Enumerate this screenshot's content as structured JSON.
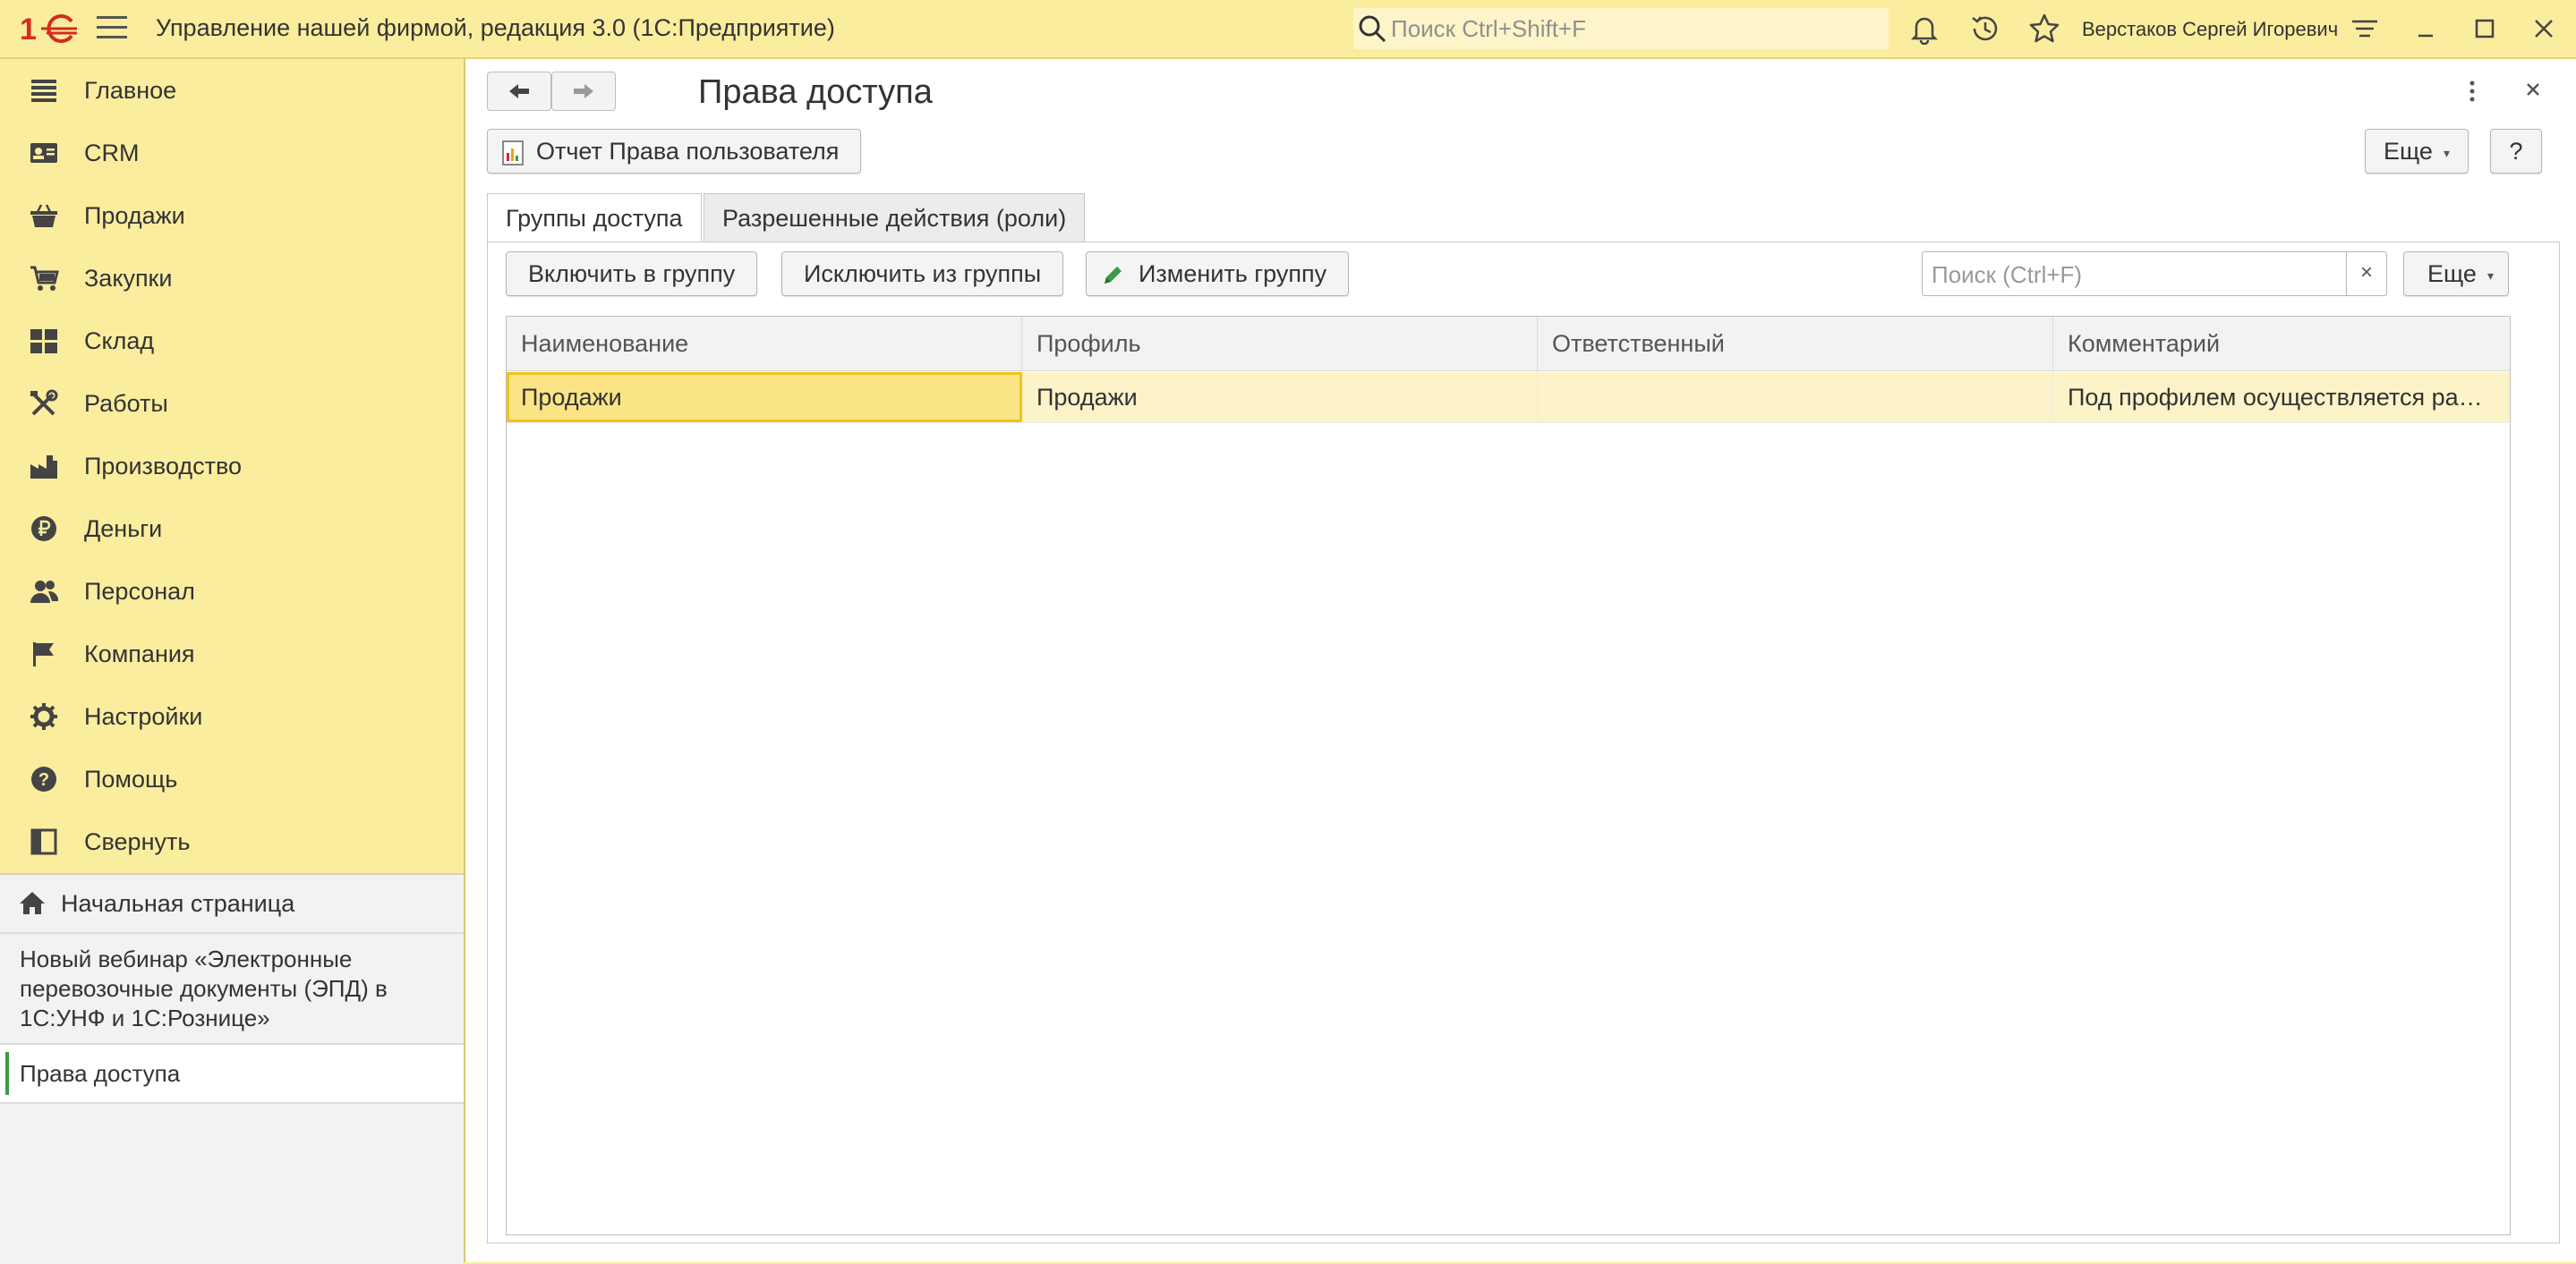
{
  "window": {
    "logo": "1С",
    "title": "Управление нашей фирмой, редакция 3.0  (1С:Предприятие)",
    "search_placeholder": "Поиск Ctrl+Shift+F",
    "user": "Верстаков Сергей Игоревич",
    "icons": [
      "menu-icon",
      "search-icon",
      "bell-icon",
      "history-icon",
      "star-icon",
      "settings-lines-icon",
      "minimize-icon",
      "maximize-icon",
      "close-icon"
    ]
  },
  "sidebar": {
    "items": [
      {
        "label": "Главное",
        "icon": "list-icon"
      },
      {
        "label": "CRM",
        "icon": "contact-card-icon"
      },
      {
        "label": "Продажи",
        "icon": "basket-icon"
      },
      {
        "label": "Закупки",
        "icon": "cart-icon"
      },
      {
        "label": "Склад",
        "icon": "grid-blocks-icon"
      },
      {
        "label": "Работы",
        "icon": "tools-icon"
      },
      {
        "label": "Производство",
        "icon": "factory-icon"
      },
      {
        "label": "Деньги",
        "icon": "ruble-icon"
      },
      {
        "label": "Персонал",
        "icon": "people-icon"
      },
      {
        "label": "Компания",
        "icon": "flag-icon"
      },
      {
        "label": "Настройки",
        "icon": "gear-icon"
      },
      {
        "label": "Помощь",
        "icon": "help-icon"
      },
      {
        "label": "Свернуть",
        "icon": "collapse-panel-icon"
      }
    ],
    "open_pages": {
      "home": "Начальная страница",
      "webinar": "Новый вебинар «Электронные перевозочные документы (ЭПД) в 1С:УНФ и 1С:Рознице»",
      "current": "Права доступа"
    }
  },
  "form": {
    "title": "Права доступа",
    "report_button": "Отчет Права пользователя",
    "more_button": "Еще",
    "help_button": "?",
    "tabs": [
      {
        "label": "Группы доступа",
        "active": true
      },
      {
        "label": "Разрешенные действия (роли)",
        "active": false
      }
    ],
    "toolbar": {
      "include": "Включить в группу",
      "exclude": "Исключить из группы",
      "edit": "Изменить группу",
      "search_placeholder": "Поиск (Ctrl+F)",
      "clear": "×",
      "more": "Еще"
    },
    "table": {
      "columns": [
        "Наименование",
        "Профиль",
        "Ответственный",
        "Комментарий"
      ],
      "rows": [
        [
          "Продажи",
          "Продажи",
          "",
          "Под профилем осуществляется ра…"
        ]
      ]
    }
  },
  "colors": {
    "panel_bg": "#fbed9e",
    "selected_row": "#fdf3c8",
    "focused_cell_border": "#f0c419",
    "logo_red": "#d52b1e",
    "edit_icon_green": "#3a9a45"
  }
}
